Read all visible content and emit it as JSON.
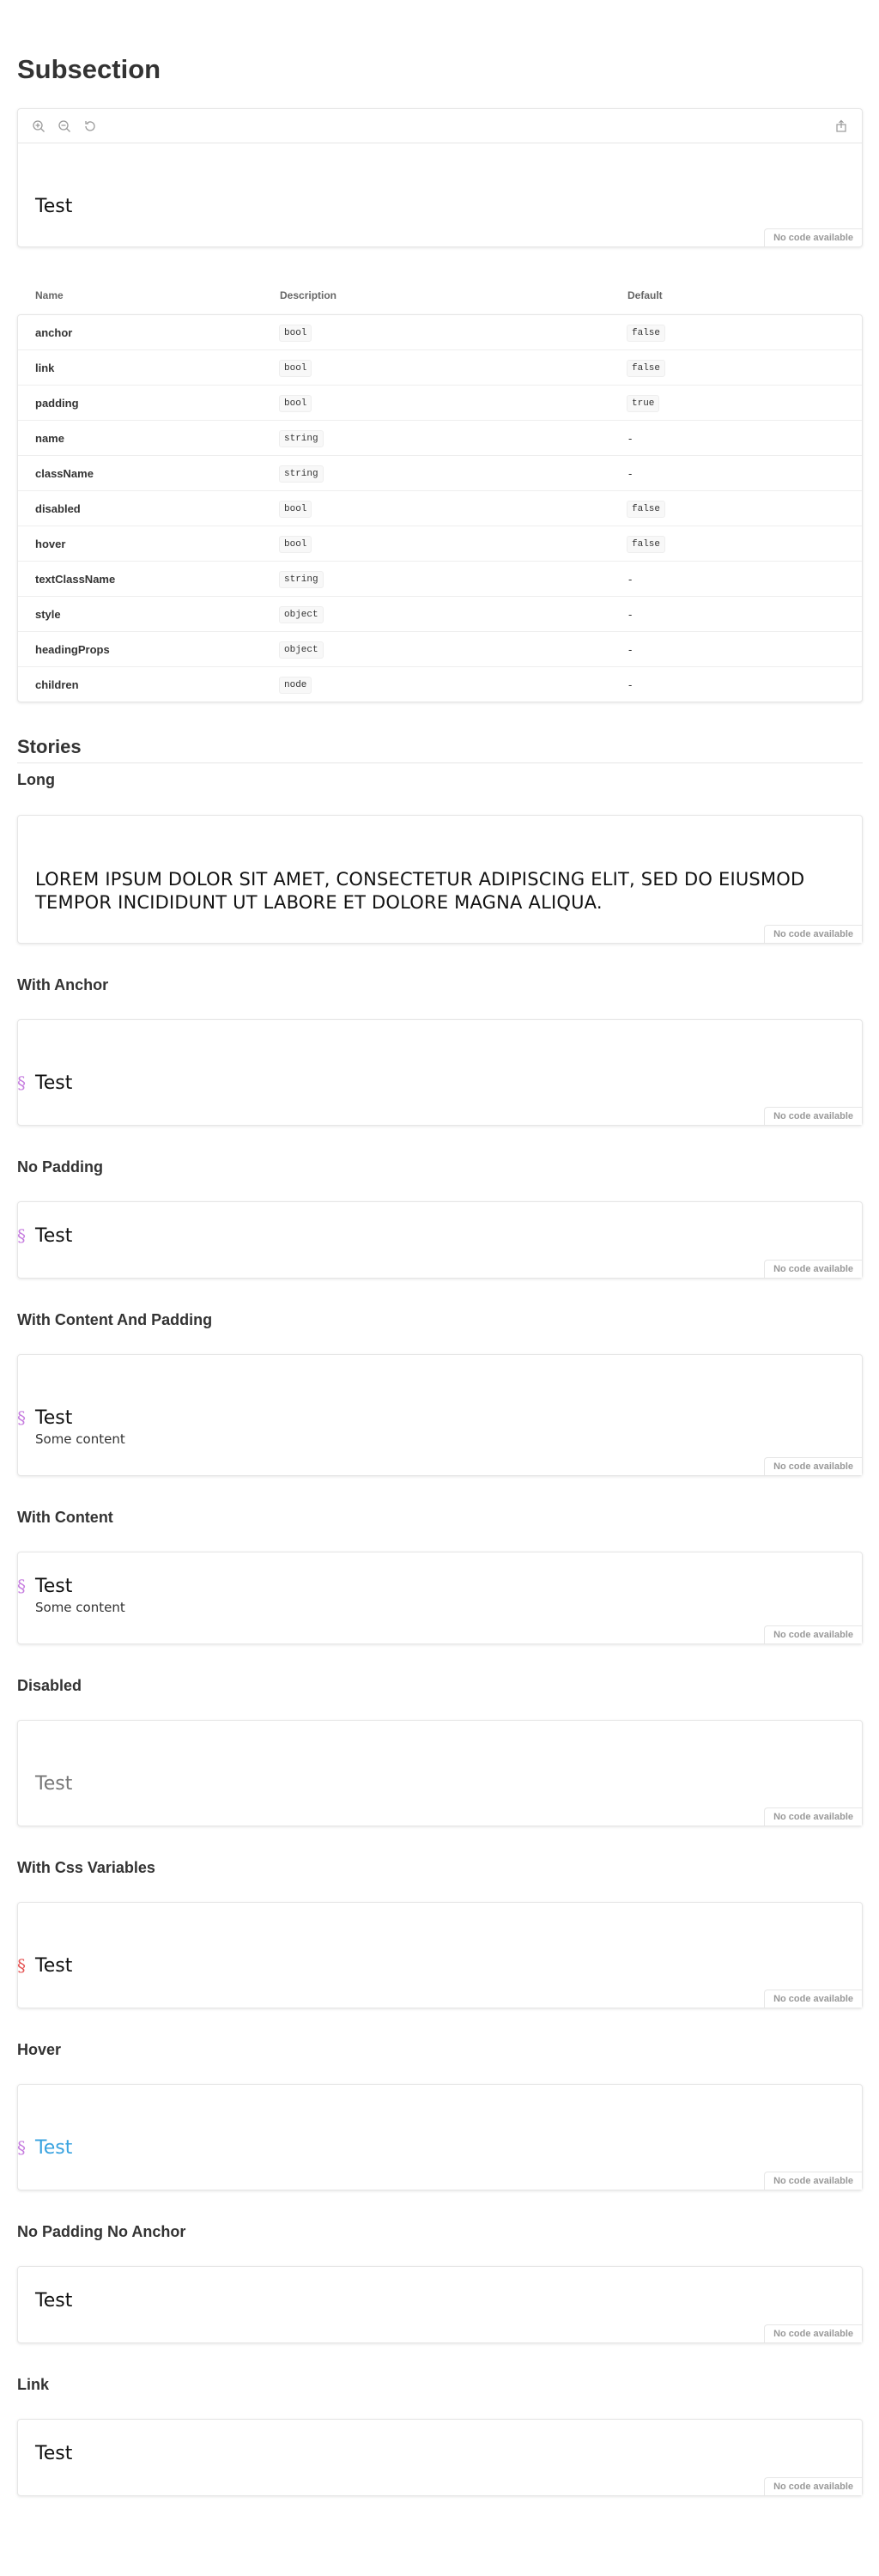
{
  "page": {
    "title": "Subsection"
  },
  "preview": {
    "tools": {
      "zoom_in": "zoom-in-icon",
      "zoom_out": "zoom-out-icon",
      "reset": "reset-zoom-icon",
      "share": "share-icon"
    },
    "heading": "Test",
    "no_code": "No code available"
  },
  "props_table": {
    "headers": {
      "name": "Name",
      "description": "Description",
      "default": "Default"
    },
    "rows": [
      {
        "name": "anchor",
        "type": "bool",
        "default": "false",
        "default_is_code": true
      },
      {
        "name": "link",
        "type": "bool",
        "default": "false",
        "default_is_code": true
      },
      {
        "name": "padding",
        "type": "bool",
        "default": "true",
        "default_is_code": true
      },
      {
        "name": "name",
        "type": "string",
        "default": "-",
        "default_is_code": false
      },
      {
        "name": "className",
        "type": "string",
        "default": "-",
        "default_is_code": false
      },
      {
        "name": "disabled",
        "type": "bool",
        "default": "false",
        "default_is_code": true
      },
      {
        "name": "hover",
        "type": "bool",
        "default": "false",
        "default_is_code": true
      },
      {
        "name": "textClassName",
        "type": "string",
        "default": "-",
        "default_is_code": false
      },
      {
        "name": "style",
        "type": "object",
        "default": "-",
        "default_is_code": false
      },
      {
        "name": "headingProps",
        "type": "object",
        "default": "-",
        "default_is_code": false
      },
      {
        "name": "children",
        "type": "node",
        "default": "-",
        "default_is_code": false
      }
    ]
  },
  "stories": {
    "title": "Stories",
    "anchor_symbol": "§",
    "no_code": "No code available",
    "items": [
      {
        "title": "Long",
        "heading": "LOREM IPSUM DOLOR SIT AMET, CONSECTETUR ADIPISCING ELIT, SED DO EIUSMOD TEMPOR INCIDIDUNT UT LABORE ET DOLORE MAGNA ALIQUA."
      },
      {
        "title": "With Anchor",
        "heading": "Test"
      },
      {
        "title": "No Padding",
        "heading": "Test"
      },
      {
        "title": "With Content And Padding",
        "heading": "Test",
        "content": "Some content"
      },
      {
        "title": "With Content",
        "heading": "Test",
        "content": "Some content"
      },
      {
        "title": "Disabled",
        "heading": "Test"
      },
      {
        "title": "With Css Variables",
        "heading": "Test"
      },
      {
        "title": "Hover",
        "heading": "Test"
      },
      {
        "title": "No Padding No Anchor",
        "heading": "Test"
      },
      {
        "title": "Link",
        "heading": "Test"
      }
    ]
  },
  "colors": {
    "anchor": "#c67ddf",
    "anchor_css_var": "#e55555",
    "hover": "#3aa3e0",
    "disabled": "#777777",
    "border": "#e6e6e6"
  }
}
